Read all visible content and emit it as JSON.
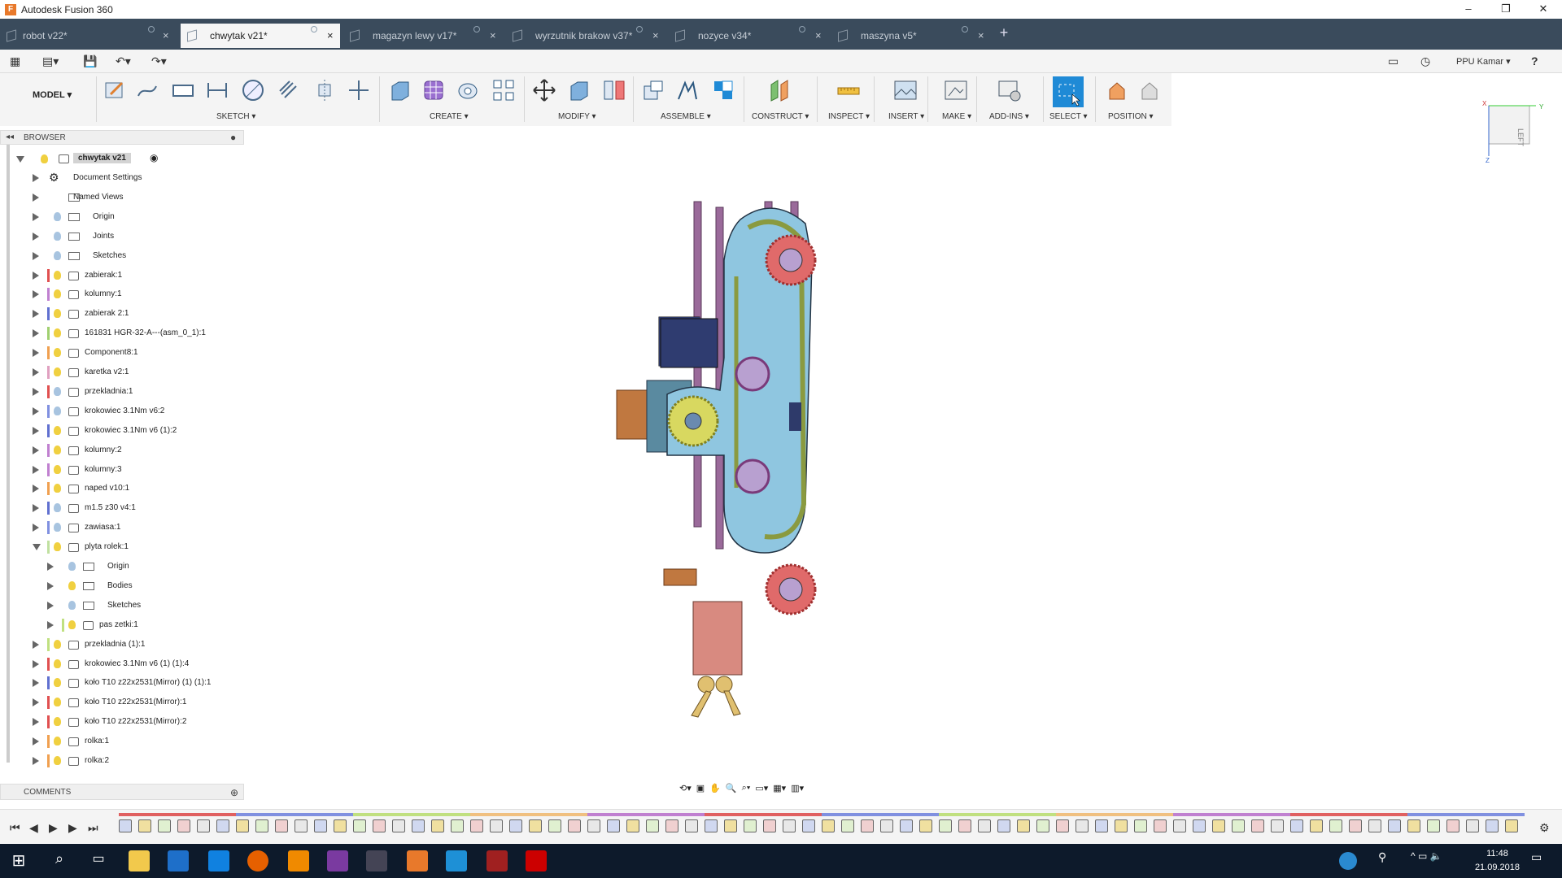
{
  "window": {
    "title": "Autodesk Fusion 360",
    "minimize": "–",
    "restore": "❐",
    "close": "✕"
  },
  "tabs": [
    {
      "label": "robot v22*",
      "active": false
    },
    {
      "label": "chwytak v21*",
      "active": true
    },
    {
      "label": "magazyn lewy v17*",
      "active": false
    },
    {
      "label": "wyrzutnik brakow v37*",
      "active": false
    },
    {
      "label": "nozyce v34*",
      "active": false
    },
    {
      "label": "maszyna v5*",
      "active": false
    }
  ],
  "quick": {
    "user": "PPU Kamar ▾",
    "help": "?"
  },
  "ribbon": {
    "mode": "MODEL ▾",
    "groups": [
      "SKETCH ▾",
      "CREATE ▾",
      "MODIFY ▾",
      "ASSEMBLE ▾",
      "CONSTRUCT ▾",
      "INSPECT ▾",
      "INSERT ▾",
      "MAKE ▾",
      "ADD-INS ▾",
      "SELECT ▾",
      "POSITION ▾"
    ]
  },
  "browser": {
    "title": "BROWSER",
    "root": "chwytak v21",
    "items": [
      {
        "label": "Document Settings",
        "kind": "gear",
        "color": "",
        "bulb": ""
      },
      {
        "label": "Named Views",
        "kind": "folder",
        "color": "",
        "bulb": ""
      },
      {
        "label": "Origin",
        "kind": "folder",
        "color": "",
        "bulb": "#a8c4e0"
      },
      {
        "label": "Joints",
        "kind": "folder",
        "color": "",
        "bulb": "#a8c4e0"
      },
      {
        "label": "Sketches",
        "kind": "folder",
        "color": "",
        "bulb": "#a8c4e0"
      },
      {
        "label": "zabierak:1",
        "kind": "comp",
        "color": "#e05050",
        "bulb": "#f0d040"
      },
      {
        "label": "kolumny:1",
        "kind": "comp",
        "color": "#c080d0",
        "bulb": "#f0d040"
      },
      {
        "label": "zabierak 2:1",
        "kind": "comp",
        "color": "#6070d0",
        "bulb": "#f0d040"
      },
      {
        "label": "161831 HGR-32-A---(asm_0_1):1",
        "kind": "link",
        "color": "#a0d070",
        "bulb": "#f0d040"
      },
      {
        "label": "Component8:1",
        "kind": "comp",
        "color": "#f0a050",
        "bulb": "#f0d040"
      },
      {
        "label": "karetka v2:1",
        "kind": "link",
        "color": "#e0a0c0",
        "bulb": "#f0d040"
      },
      {
        "label": "przekladnia:1",
        "kind": "comp",
        "color": "#e05050",
        "bulb": "#a8c4e0"
      },
      {
        "label": "krokowiec 3.1Nm v6:2",
        "kind": "comp",
        "color": "#8090e0",
        "bulb": "#a8c4e0"
      },
      {
        "label": "krokowiec 3.1Nm v6 (1):2",
        "kind": "comp",
        "color": "#6070d0",
        "bulb": "#f0d040"
      },
      {
        "label": "kolumny:2",
        "kind": "comp",
        "color": "#c080d0",
        "bulb": "#f0d040"
      },
      {
        "label": "kolumny:3",
        "kind": "comp",
        "color": "#c080d0",
        "bulb": "#f0d040"
      },
      {
        "label": "naped v10:1",
        "kind": "link",
        "color": "#f0a050",
        "bulb": "#f0d040"
      },
      {
        "label": "m1.5 z30 v4:1",
        "kind": "comp",
        "color": "#6070d0",
        "bulb": "#a8c4e0"
      },
      {
        "label": "zawiasa:1",
        "kind": "comp",
        "color": "#8090e0",
        "bulb": "#a8c4e0"
      },
      {
        "label": "plyta rolek:1",
        "kind": "comp",
        "color": "#c0e0a0",
        "bulb": "#f0d040",
        "open": true
      },
      {
        "label": "Origin",
        "kind": "folder",
        "color": "",
        "bulb": "#a8c4e0",
        "indent": 1
      },
      {
        "label": "Bodies",
        "kind": "folder",
        "color": "",
        "bulb": "#f0d040",
        "indent": 1
      },
      {
        "label": "Sketches",
        "kind": "folder",
        "color": "",
        "bulb": "#a8c4e0",
        "indent": 1
      },
      {
        "label": "pas zetki:1",
        "kind": "comp",
        "color": "#c0e080",
        "bulb": "#f0d040",
        "indent": 1
      },
      {
        "label": "przekladnia (1):1",
        "kind": "comp",
        "color": "#c0e080",
        "bulb": "#f0d040"
      },
      {
        "label": "krokowiec 3.1Nm v6 (1) (1):4",
        "kind": "comp",
        "color": "#e05050",
        "bulb": "#f0d040"
      },
      {
        "label": "koło T10 z22x2531(Mirror) (1) (1):1",
        "kind": "comp",
        "color": "#6070d0",
        "bulb": "#f0d040"
      },
      {
        "label": "koło T10 z22x2531(Mirror):1",
        "kind": "comp",
        "color": "#e05050",
        "bulb": "#f0d040"
      },
      {
        "label": "koło T10 z22x2531(Mirror):2",
        "kind": "comp",
        "color": "#e05050",
        "bulb": "#f0d040"
      },
      {
        "label": "rolka:1",
        "kind": "comp",
        "color": "#f0a050",
        "bulb": "#f0d040"
      },
      {
        "label": "rolka:2",
        "kind": "comp",
        "color": "#f0a050",
        "bulb": "#f0d040"
      }
    ]
  },
  "comments": {
    "title": "COMMENTS"
  },
  "viewcube": {
    "face": "LEFT",
    "axis_x": "X",
    "axis_y": "Y",
    "axis_z": "Z"
  },
  "taskbar": {
    "time": "11:48",
    "date": "21.09.2018"
  }
}
